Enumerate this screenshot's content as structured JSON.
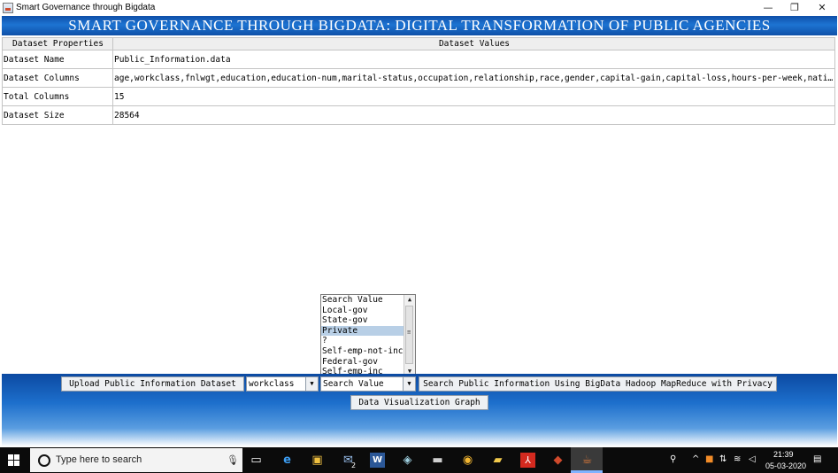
{
  "window": {
    "title": "Smart Governance through Bigdata",
    "minimize": "—",
    "restore": "❐",
    "close": "✕"
  },
  "banner": "SMART GOVERNANCE THROUGH BIGDATA: DIGITAL TRANSFORMATION OF PUBLIC AGENCIES",
  "table": {
    "headers": [
      "Dataset Properties",
      "Dataset Values"
    ],
    "rows": [
      {
        "property": "Dataset Name",
        "value": "Public_Information.data"
      },
      {
        "property": "Dataset Columns",
        "value": "age,workclass,fnlwgt,education,education-num,marital-status,occupation,relationship,race,gender,capital-gain,capital-loss,hours-per-week,native-..."
      },
      {
        "property": "Total Columns",
        "value": "15"
      },
      {
        "property": "Dataset Size",
        "value": "28564"
      }
    ]
  },
  "listbox": {
    "items": [
      "Search Value",
      "Local-gov",
      "State-gov",
      "Private",
      "?",
      "Self-emp-not-inc",
      "Federal-gov",
      "Self-emp-inc"
    ],
    "selected": "Private"
  },
  "controls": {
    "upload_button": "Upload Public Information Dataset",
    "column_combo": "workclass",
    "value_combo": "Search Value",
    "search_button": "Search Public Information Using BigData Hadoop MapReduce with Privacy",
    "graph_button": "Data Visualization Graph"
  },
  "taskbar": {
    "search_placeholder": "Type here to search",
    "time": "21:39",
    "date": "05-03-2020",
    "notification_count": "2"
  },
  "colors": {
    "banner": "#1d6fcc",
    "panel": "#0c4aa2",
    "selected_item": "#b8cfe6",
    "taskbar": "#0b0b0b"
  }
}
